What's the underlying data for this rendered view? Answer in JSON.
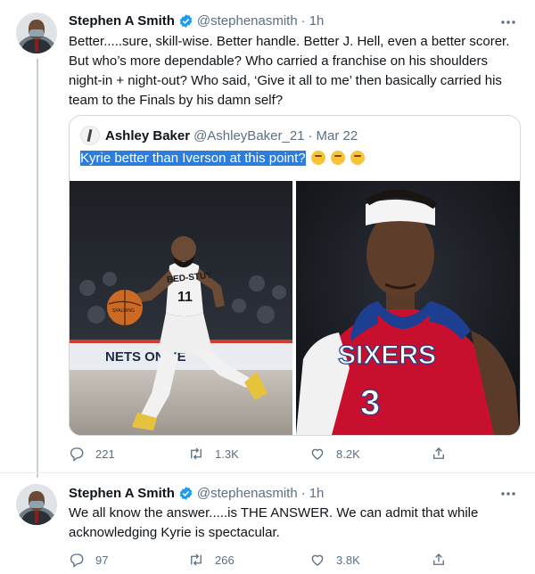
{
  "tweets": [
    {
      "name": "Stephen A Smith",
      "handle": "@stephenasmith",
      "separator": "·",
      "time": "1h",
      "text": "Better.....sure, skill-wise. Better handle. Better J. Hell, even a better scorer. But who’s more dependable? Who carried a franchise on his shoulders night-in + night-out? Who said, ‘Give it all to me’ then basically carried his team to the Finals by his damn self?",
      "quote": {
        "name": "Ashley Baker",
        "handle": "@AshleyBaker_21",
        "separator": "·",
        "time": "Mar 22",
        "text": "Kyrie better than Iverson at this point?",
        "emojis": [
          "thinking-face",
          "thinking-face",
          "thinking-face"
        ],
        "images": [
          {
            "jersey_text": "BED-STUY",
            "number": "11",
            "ball_text": "SPALDING",
            "board_text": "NETS ON YE"
          },
          {
            "jersey_text": "SIXERS",
            "number": "3"
          }
        ]
      },
      "stats": {
        "replies": "221",
        "retweets": "1.3K",
        "likes": "8.2K"
      }
    },
    {
      "name": "Stephen A Smith",
      "handle": "@stephenasmith",
      "separator": "·",
      "time": "1h",
      "text": "We all know the answer.....is THE ANSWER. We can admit that while acknowledging Kyrie is spectacular.",
      "stats": {
        "replies": "97",
        "retweets": "266",
        "likes": "3.8K"
      }
    }
  ],
  "colors": {
    "text": "#0f1419",
    "secondary": "#5b7083",
    "verified": "#1d9bf0",
    "highlight": "#2b7de0"
  }
}
